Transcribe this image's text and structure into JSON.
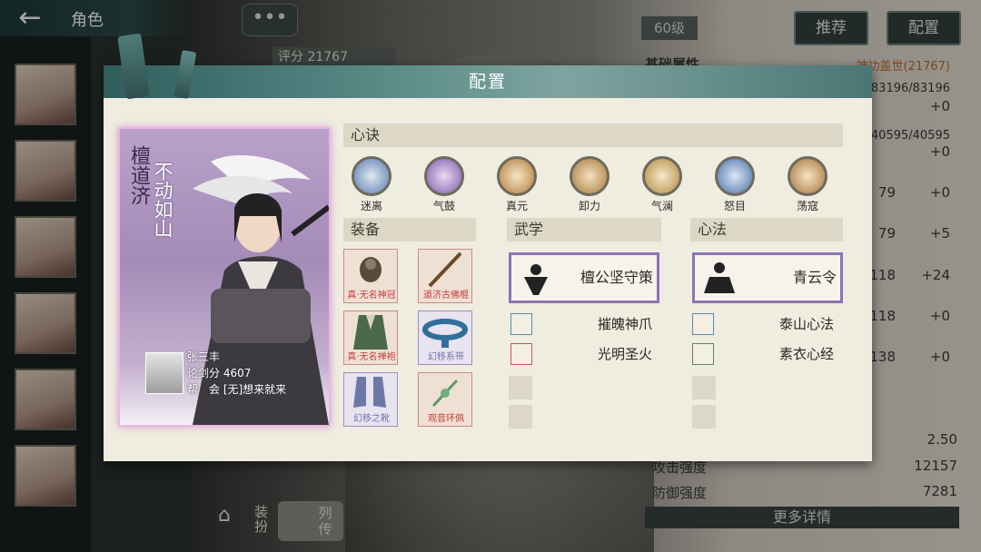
{
  "topbar": {
    "back_icon": "back-arrow-icon",
    "title": "角色",
    "chat_icon": "chat-bubble-icon",
    "chat_glyph": "•••"
  },
  "score_strip": {
    "text": "评分 21767"
  },
  "level_badge": "60级",
  "top_buttons": {
    "recommend": "推荐",
    "config": "配置"
  },
  "right_stats": {
    "header_label": "基础属性",
    "header_value": "神功盖世(21767)",
    "rows": [
      {
        "value": "83196/83196",
        "bonus": "+0"
      },
      {
        "value": "40595/40595",
        "bonus": "+0"
      },
      {
        "value": "79",
        "bonus": "+0"
      },
      {
        "value": "79",
        "bonus": "+5"
      },
      {
        "value": "118",
        "bonus": "+24"
      },
      {
        "value": "118",
        "bonus": "+0"
      },
      {
        "value": "138",
        "bonus": "+0"
      }
    ],
    "bottom": [
      {
        "label": "",
        "value": "2.50"
      },
      {
        "label": "攻击强度",
        "value": "12157"
      },
      {
        "label": "防御强度",
        "value": "7281"
      }
    ],
    "more_button": "更多详情"
  },
  "bottom_buttons": {
    "dress": "装扮",
    "bio": "列传"
  },
  "modal": {
    "title": "配置",
    "card": {
      "name": "檀道济",
      "motto": "不动如山",
      "owner_name": "张三丰",
      "owner_score": "论剑分 4607",
      "owner_guild": "帮　会 [无]想来就来"
    },
    "xinjue": {
      "header": "心诀",
      "skills": [
        {
          "label": "迷离",
          "color": "#5a7bb0"
        },
        {
          "label": "气鼓",
          "color": "#7d5aa8"
        },
        {
          "label": "真元",
          "color": "#b07a3a"
        },
        {
          "label": "卸力",
          "color": "#a87a3a"
        },
        {
          "label": "气澜",
          "color": "#b08a40"
        },
        {
          "label": "怒目",
          "color": "#4a6fa8"
        },
        {
          "label": "荡寇",
          "color": "#a8743a"
        }
      ]
    },
    "equipment": {
      "header": "装备",
      "items": [
        {
          "caption": "真·无名神冠",
          "rarity": "red"
        },
        {
          "caption": "道济古佛棍",
          "rarity": "red"
        },
        {
          "caption": "真·无名禅袍",
          "rarity": "red"
        },
        {
          "caption": "幻移系带",
          "rarity": "blue"
        },
        {
          "caption": "幻移之靴",
          "rarity": "blue"
        },
        {
          "caption": "观音环佩",
          "rarity": "red"
        }
      ]
    },
    "wuxue": {
      "header": "武学",
      "main": "檀公坚守策",
      "subs": [
        {
          "name": "摧魄神爪",
          "icon": "claw-icon"
        },
        {
          "name": "光明圣火",
          "icon": "flame-icon"
        }
      ]
    },
    "xinfa": {
      "header": "心法",
      "main": "青云令",
      "subs": [
        {
          "name": "泰山心法",
          "icon": "mountain-icon"
        },
        {
          "name": "素衣心经",
          "icon": "scripture-icon"
        }
      ]
    }
  }
}
